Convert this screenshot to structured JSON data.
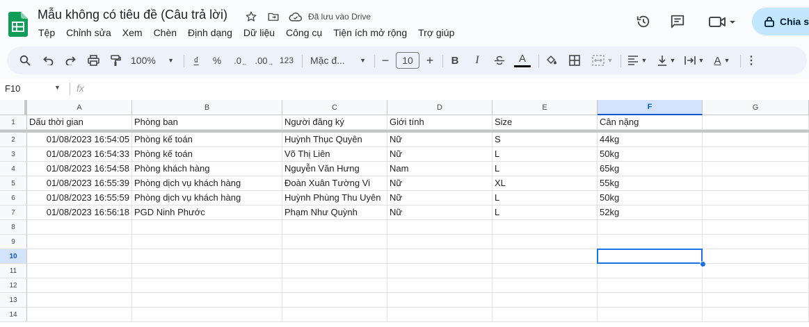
{
  "header": {
    "title": "Mẫu không có tiêu đề (Câu trả lời)",
    "saved_status": "Đã lưu vào Drive",
    "menu": [
      "Tệp",
      "Chỉnh sửa",
      "Xem",
      "Chèn",
      "Định dạng",
      "Dữ liệu",
      "Công cụ",
      "Tiện ích mở rộng",
      "Trợ giúp"
    ],
    "share_label": "Chia s"
  },
  "toolbar": {
    "zoom": "100%",
    "currency": "₫",
    "percent": "%",
    "dec_decrease": ".0",
    "dec_increase": ".00",
    "number_format": "123",
    "font": "Mặc đ...",
    "font_size": "10",
    "bold": "B",
    "italic": "I",
    "text_color_letter": "A",
    "text_rotate_letter": "A"
  },
  "formula_bar": {
    "name_box": "F10",
    "fx": "fx",
    "value": ""
  },
  "columns": [
    "A",
    "B",
    "C",
    "D",
    "E",
    "F",
    "G"
  ],
  "selected_column": "F",
  "row_numbers": [
    "1",
    "2",
    "3",
    "4",
    "5",
    "6",
    "7",
    "8",
    "9",
    "10",
    "11",
    "12",
    "13",
    "14"
  ],
  "selected_row": "10",
  "rows": [
    [
      "Dấu thời gian",
      "Phòng ban",
      "Người đăng ký",
      "Giới tính",
      "Size",
      "Cân nặng",
      ""
    ],
    [
      "01/08/2023 16:54:05",
      "Phòng kế toán",
      "Huỳnh Thục Quyên",
      "Nữ",
      "S",
      "44kg",
      ""
    ],
    [
      "01/08/2023 16:54:33",
      "Phòng kế toán",
      "Võ Thị Liên",
      "Nữ",
      "L",
      "50kg",
      ""
    ],
    [
      "01/08/2023 16:54:58",
      "Phòng khách hàng",
      "Nguyễn Văn Hưng",
      "Nam",
      "L",
      "65kg",
      ""
    ],
    [
      "01/08/2023 16:55:39",
      "Phòng dịch vụ khách hàng",
      "Đoàn Xuân Tường Vi",
      "Nữ",
      "XL",
      "55kg",
      ""
    ],
    [
      "01/08/2023 16:55:59",
      "Phòng dịch vụ khách hàng",
      "Huỳnh Phùng Thu Uyên",
      "Nữ",
      "L",
      "50kg",
      ""
    ],
    [
      "01/08/2023 16:56:18",
      "PGD Ninh Phước",
      "Phạm Như Quỳnh",
      "Nữ",
      "L",
      "52kg",
      ""
    ],
    [
      "",
      "",
      "",
      "",
      "",
      "",
      ""
    ],
    [
      "",
      "",
      "",
      "",
      "",
      "",
      ""
    ],
    [
      "",
      "",
      "",
      "",
      "",
      "",
      ""
    ],
    [
      "",
      "",
      "",
      "",
      "",
      "",
      ""
    ],
    [
      "",
      "",
      "",
      "",
      "",
      "",
      ""
    ],
    [
      "",
      "",
      "",
      "",
      "",
      "",
      ""
    ],
    [
      "",
      "",
      "",
      "",
      "",
      "",
      ""
    ]
  ],
  "colors": {
    "accent": "#1a73e8",
    "selected_header": "#d3e3fd",
    "share_bg": "#c2e7ff",
    "sheets_green": "#0f9d58"
  }
}
